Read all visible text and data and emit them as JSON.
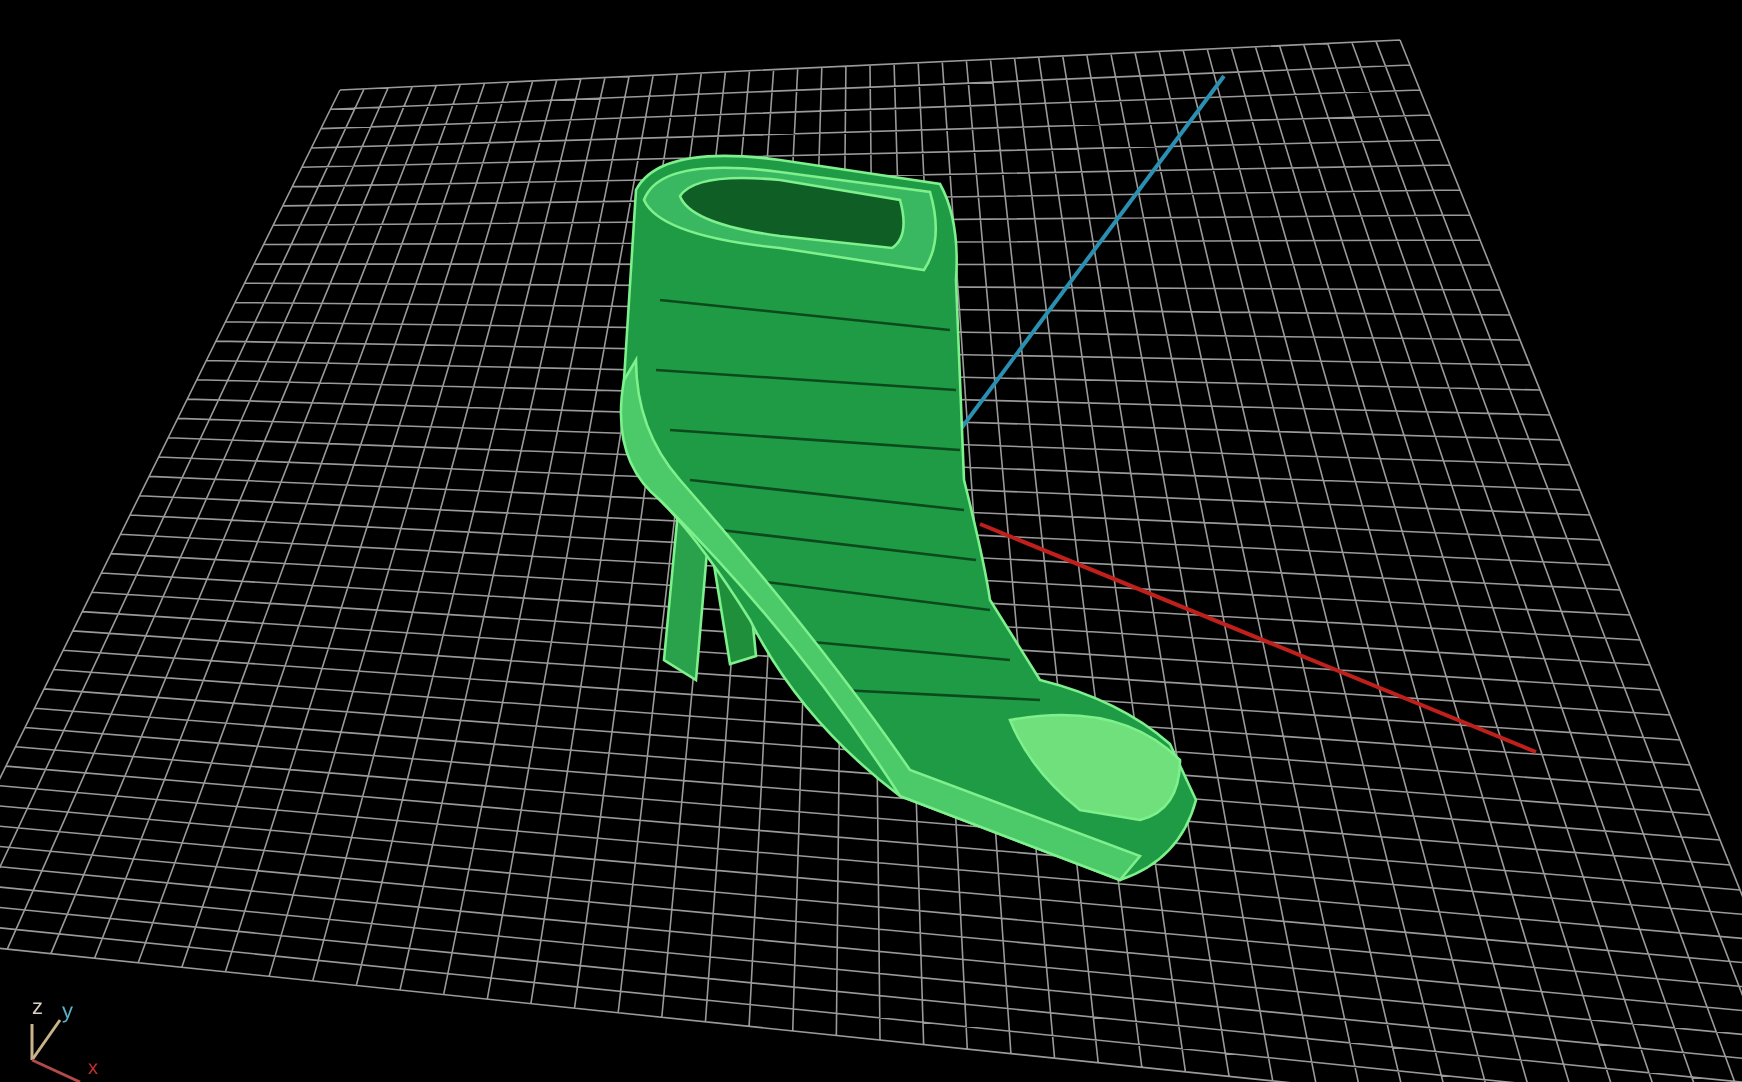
{
  "viewport": {
    "axis_indicator": {
      "z": "z",
      "y": "y",
      "x": "x"
    }
  }
}
